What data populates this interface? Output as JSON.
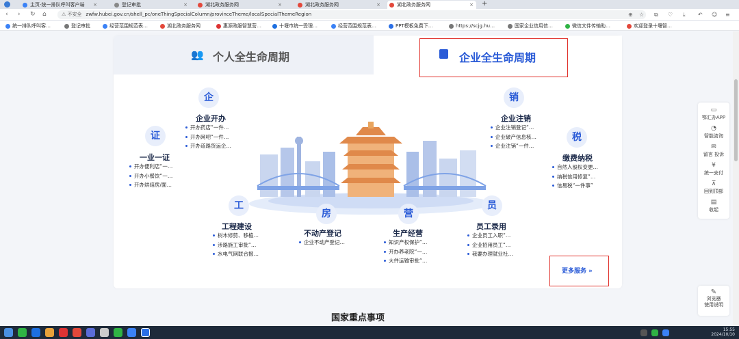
{
  "browser": {
    "tabs": [
      {
        "label": "主页-统一排队呼叫客户端",
        "active": false
      },
      {
        "label": "登记审批",
        "active": false
      },
      {
        "label": "湖北政务服务网",
        "active": false
      },
      {
        "label": "湖北政务服务网",
        "active": false
      },
      {
        "label": "湖北政务服务网",
        "active": true
      }
    ],
    "new_tab": "+",
    "security_label": "不安全",
    "url": "zwfw.hubei.gov.cn/shell_pc/oneThingSpecialColumn/provinceTheme/localSpecialThemeRegion",
    "bookmarks": [
      "统一排队呼叫客…",
      "登记审批",
      "经营范围规范表…",
      "湖北政务服务网",
      "惠源政服智慧营…",
      "十堰市统一受理…",
      "经营范围规范表…",
      "PPT模板免费下…",
      "https://scjg.hu…",
      "国家企业信用信…",
      "微信文件传输助…",
      "欢迎登录十堰智…"
    ]
  },
  "panel": {
    "tab_personal": "个人全生命周期",
    "tab_enterprise": "企业全生命周期",
    "categories": {
      "kaiban": {
        "title": "企业开办",
        "icon": "企",
        "items": [
          "开办药店“一件…",
          "开办网吧“一件…",
          "开办道路货运企…"
        ]
      },
      "yiyeyizheng": {
        "title": "一业一证",
        "icon": "证",
        "items": [
          "开办便利店“一…",
          "开办小餐饮“一…",
          "开办烘焙房/面…"
        ]
      },
      "zhuxiao": {
        "title": "企业注销",
        "icon": "销",
        "items": [
          "企业注销登记“…",
          "企业破产信息核…",
          "企业注销“一件…"
        ]
      },
      "jiaofei": {
        "title": "缴费纳税",
        "icon": "税",
        "items": [
          "自然人股权变更…",
          "纳税信用修复“…",
          "信易税“一件事”"
        ]
      },
      "gongcheng": {
        "title": "工程建设",
        "icon": "工",
        "items": [
          "树木修剪、移植…",
          "涉路施工审批“…",
          "水电气网联合报…"
        ]
      },
      "budongchan": {
        "title": "不动产登记",
        "icon": "房",
        "items": [
          "企业不动产登记…"
        ]
      },
      "shengchan": {
        "title": "生产经营",
        "icon": "营",
        "items": [
          "知识产权保护“…",
          "开办养老院“一…",
          "大件运输审批“…"
        ]
      },
      "yuangong": {
        "title": "员工录用",
        "icon": "员",
        "items": [
          "企业员工入职“…",
          "企业招用员工“…",
          "我要办理就业社…"
        ]
      }
    },
    "more_services": "更多服务 »"
  },
  "section_title": "国家重点事项",
  "sidebar": [
    {
      "icon": "▭",
      "label": "鄂汇办APP"
    },
    {
      "icon": "◔",
      "label": "智能咨询"
    },
    {
      "icon": "✉",
      "label": "留言 投诉"
    },
    {
      "icon": "¥",
      "label": "统一支付"
    },
    {
      "icon": "⊼",
      "label": "回到顶部"
    },
    {
      "icon": "▤",
      "label": "收起"
    }
  ],
  "browser_help": {
    "icon": "✎",
    "label1": "浏览器",
    "label2": "使用说明"
  },
  "taskbar": {
    "time": "15:55",
    "date": "2024/10/10"
  },
  "colors": {
    "accent": "#2a5bd7",
    "highlight_box": "#e0302a"
  }
}
